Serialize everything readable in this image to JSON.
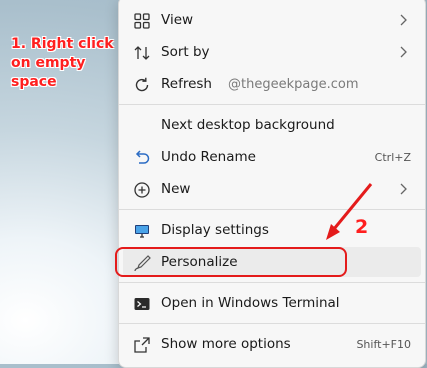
{
  "annotations": {
    "step1": "1. Right click on empty space",
    "step2": "2",
    "watermark": "@thegeekpage.com"
  },
  "colors": {
    "annotation_red": "#e41b1b",
    "menu_bg": "#f7f7f7",
    "highlight": "#ebebeb"
  },
  "menu": {
    "items": [
      {
        "label": "View",
        "icon": "grid-icon",
        "submenu": true
      },
      {
        "label": "Sort by",
        "icon": "sort-icon",
        "submenu": true
      },
      {
        "label": "Refresh",
        "icon": "refresh-icon"
      },
      {
        "label": "Next desktop background"
      },
      {
        "label": "Undo Rename",
        "icon": "undo-icon",
        "shortcut": "Ctrl+Z"
      },
      {
        "label": "New",
        "icon": "plus-circle-icon",
        "submenu": true
      },
      {
        "label": "Display settings",
        "icon": "display-icon"
      },
      {
        "label": "Personalize",
        "icon": "brush-icon"
      },
      {
        "label": "Open in Windows Terminal",
        "icon": "terminal-icon"
      },
      {
        "label": "Show more options",
        "icon": "share-icon",
        "shortcut": "Shift+F10"
      }
    ]
  }
}
